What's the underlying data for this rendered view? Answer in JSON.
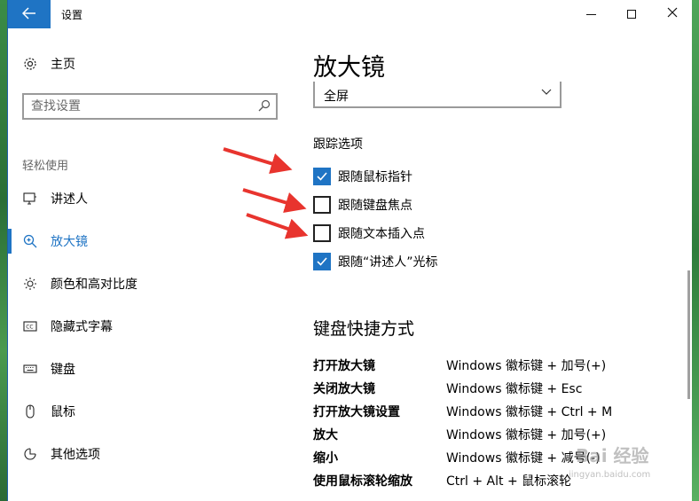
{
  "window": {
    "title": "设置",
    "back_icon": "arrow-left-icon",
    "controls": [
      "minimize",
      "maximize",
      "close"
    ]
  },
  "sidebar": {
    "home": {
      "label": "主页",
      "icon": "gear-icon"
    },
    "search": {
      "placeholder": "查找设置",
      "icon": "search-icon"
    },
    "section": "轻松使用",
    "items": [
      {
        "label": "讲述人",
        "icon": "narrator-icon",
        "active": false
      },
      {
        "label": "放大镜",
        "icon": "magnifier-icon",
        "active": true
      },
      {
        "label": "颜色和高对比度",
        "icon": "brightness-icon",
        "active": false
      },
      {
        "label": "隐藏式字幕",
        "icon": "closed-caption-icon",
        "active": false
      },
      {
        "label": "键盘",
        "icon": "keyboard-icon",
        "active": false
      },
      {
        "label": "鼠标",
        "icon": "mouse-icon",
        "active": false
      },
      {
        "label": "其他选项",
        "icon": "other-options-icon",
        "active": false
      }
    ],
    "accent": "#1f74c4"
  },
  "main": {
    "title": "放大镜",
    "view_mode": {
      "value": "全屏"
    },
    "tracking": {
      "title": "跟踪选项",
      "options": [
        {
          "label": "跟随鼠标指针",
          "checked": true
        },
        {
          "label": "跟随键盘焦点",
          "checked": false
        },
        {
          "label": "跟随文本插入点",
          "checked": false
        },
        {
          "label": "跟随“讲述人”光标",
          "checked": true
        }
      ]
    },
    "shortcuts": {
      "title": "键盘快捷方式",
      "rows": [
        {
          "name": "打开放大镜",
          "keys": "Windows 徽标键 + 加号(+)"
        },
        {
          "name": "关闭放大镜",
          "keys": "Windows 徽标键 + Esc"
        },
        {
          "name": "打开放大镜设置",
          "keys": "Windows 徽标键 + Ctrl + M"
        },
        {
          "name": "放大",
          "keys": "Windows 徽标键 + 加号(+)"
        },
        {
          "name": "缩小",
          "keys": "Windows 徽标键 + 减号(-)"
        },
        {
          "name": "使用鼠标滚轮缩放",
          "keys": "Ctrl + Alt + 鼠标滚轮"
        }
      ]
    }
  },
  "watermark": {
    "text": "Bai 经验",
    "sub": "jingyan.baidu.com"
  },
  "annotation_color": "#e8342e"
}
